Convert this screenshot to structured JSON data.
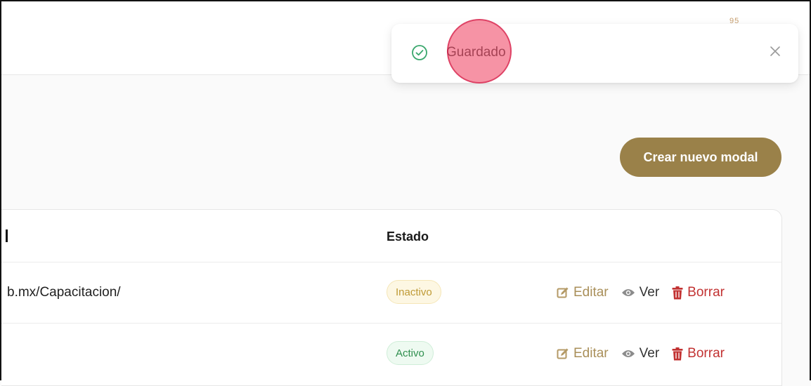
{
  "header": {
    "avatar_peek": "95"
  },
  "toast": {
    "message": "Guardado",
    "status": "success",
    "icon": "check-circle-icon",
    "close_icon": "close-icon"
  },
  "toolbar": {
    "create_label": "Crear nuevo modal"
  },
  "table": {
    "columns": [
      "Estado"
    ],
    "rows": [
      {
        "url": "b.mx/Capacitacion/",
        "status": "Inactivo",
        "actions": {
          "edit": "Editar",
          "view": "Ver",
          "delete": "Borrar"
        }
      },
      {
        "url": "",
        "status": "Activo",
        "actions": {
          "edit": "Editar",
          "view": "Ver",
          "delete": "Borrar"
        }
      }
    ]
  },
  "colors": {
    "accent": "#9a8149",
    "success": "#3aa76d",
    "danger": "#c23232",
    "warning": "#bf9a35"
  }
}
